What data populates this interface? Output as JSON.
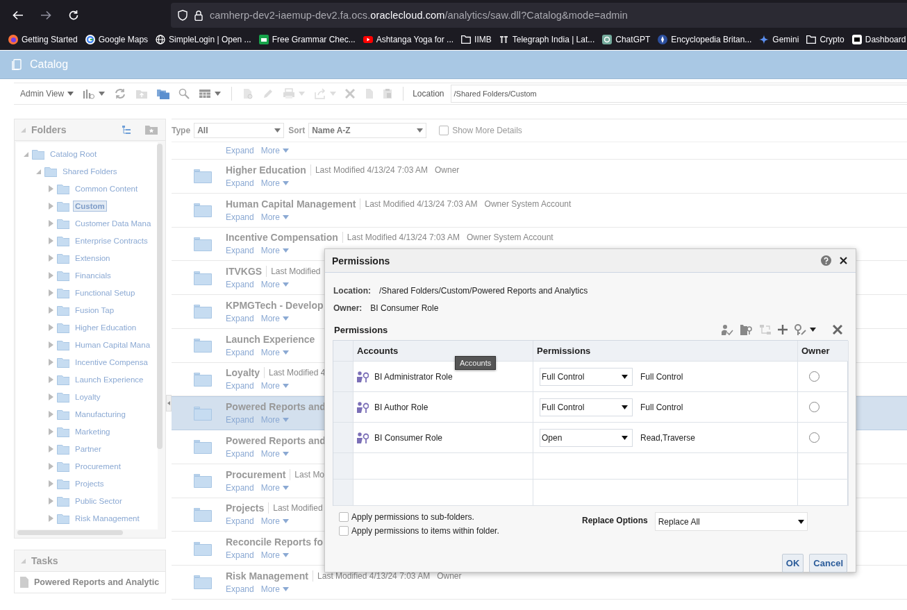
{
  "browser": {
    "url": "camherp-dev2-iaemup-dev2.fa.ocs.**oraclecloud.com**/analytics/saw.dll?Catalog&mode=admin",
    "bookmarks": [
      {
        "label": "Getting Started",
        "kind": "link"
      },
      {
        "label": "Google Maps",
        "kind": "link"
      },
      {
        "label": "SimpleLogin | Open ...",
        "kind": "link"
      },
      {
        "label": "Free Grammar Chec...",
        "kind": "link"
      },
      {
        "label": "Ashtanga Yoga for ...",
        "kind": "link"
      },
      {
        "label": "IIMB",
        "kind": "folder"
      },
      {
        "label": "Telegraph India | Lat...",
        "kind": "link"
      },
      {
        "label": "ChatGPT",
        "kind": "link"
      },
      {
        "label": "Encyclopedia Britan...",
        "kind": "link"
      },
      {
        "label": "Gemini",
        "kind": "link"
      },
      {
        "label": "Crypto",
        "kind": "folder"
      },
      {
        "label": "Dashboard",
        "kind": "link"
      }
    ]
  },
  "app": {
    "title": "Catalog"
  },
  "toolbar": {
    "view": "Admin View",
    "location_label": "Location",
    "location": "/Shared Folders/Custom"
  },
  "folders": {
    "title": "Folders",
    "tree": [
      {
        "label": "Catalog Root",
        "expanded": true,
        "selected": false,
        "children": [
          {
            "label": "Shared Folders",
            "expanded": true,
            "selected": false,
            "children": [
              {
                "label": "Common Content",
                "expanded": false,
                "selected": false
              },
              {
                "label": "Custom",
                "expanded": false,
                "selected": true
              },
              {
                "label": "Customer Data Mana",
                "expanded": false,
                "selected": false
              },
              {
                "label": "Enterprise Contracts",
                "expanded": false,
                "selected": false
              },
              {
                "label": "Extension",
                "expanded": false,
                "selected": false
              },
              {
                "label": "Financials",
                "expanded": false,
                "selected": false
              },
              {
                "label": "Functional Setup",
                "expanded": false,
                "selected": false
              },
              {
                "label": "Fusion Tap",
                "expanded": false,
                "selected": false
              },
              {
                "label": "Higher Education",
                "expanded": false,
                "selected": false
              },
              {
                "label": "Human Capital Mana",
                "expanded": false,
                "selected": false
              },
              {
                "label": "Incentive Compensa",
                "expanded": false,
                "selected": false
              },
              {
                "label": "Launch Experience",
                "expanded": false,
                "selected": false
              },
              {
                "label": "Loyalty",
                "expanded": false,
                "selected": false
              },
              {
                "label": "Manufacturing",
                "expanded": false,
                "selected": false
              },
              {
                "label": "Marketing",
                "expanded": false,
                "selected": false
              },
              {
                "label": "Partner",
                "expanded": false,
                "selected": false
              },
              {
                "label": "Procurement",
                "expanded": false,
                "selected": false
              },
              {
                "label": "Projects",
                "expanded": false,
                "selected": false
              },
              {
                "label": "Public Sector",
                "expanded": false,
                "selected": false
              },
              {
                "label": "Risk Management",
                "expanded": false,
                "selected": false
              }
            ]
          }
        ]
      }
    ]
  },
  "tasks": {
    "title": "Tasks",
    "item": "Powered Reports and Analytic"
  },
  "filters": {
    "type_label": "Type",
    "type": "All",
    "sort_label": "Sort",
    "sort": "Name A-Z",
    "details_label": "Show More Details",
    "details_checked": false
  },
  "items": [
    {
      "expand": "Expand",
      "more": "More",
      "selected": false
    },
    {
      "title": "Higher Education",
      "modified": "Last Modified 4/13/24 7:03 AM",
      "owner": "Owner",
      "expand": "Expand",
      "more": "More",
      "selected": false
    },
    {
      "title": "Human Capital Management",
      "modified": "Last Modified 4/13/24 7:03 AM",
      "owner": "Owner System Account",
      "expand": "Expand",
      "more": "More",
      "selected": false
    },
    {
      "title": "Incentive Compensation",
      "modified": "Last Modified 4/13/24 7:03 AM",
      "owner": "Owner System Account",
      "expand": "Expand",
      "more": "More",
      "selected": false
    },
    {
      "title": "ITVKGS",
      "modified": "Last Modified",
      "expand": "Expand",
      "more": "More",
      "selected": false
    },
    {
      "title": "KPMGTech - Develop",
      "expand": "Expand",
      "more": "More",
      "selected": false
    },
    {
      "title": "Launch Experience",
      "expand": "Expand",
      "more": "More",
      "selected": false
    },
    {
      "title": "Loyalty",
      "modified": "Last Modified 4",
      "expand": "Expand",
      "more": "More",
      "selected": false
    },
    {
      "title": "Powered Reports and",
      "expand": "Expand",
      "more": "More",
      "selected": true
    },
    {
      "title": "Powered Reports and",
      "expand": "Expand",
      "more": "More",
      "selected": false
    },
    {
      "title": "Procurement",
      "modified": "Last Mo",
      "expand": "Expand",
      "more": "More",
      "selected": false
    },
    {
      "title": "Projects",
      "modified": "Last Modified",
      "expand": "Expand",
      "more": "More",
      "selected": false
    },
    {
      "title": "Reconcile Reports fo",
      "expand": "Expand",
      "more": "More",
      "selected": false
    },
    {
      "title": "Risk Management",
      "modified": "Last Modified 4/13/24 7:03 AM",
      "owner": "Owner",
      "expand": "Expand",
      "more": "More",
      "selected": false
    }
  ],
  "dialog": {
    "title": "Permissions",
    "location_label": "Location:",
    "location": "/Shared Folders/Custom/Powered Reports and Analytics",
    "owner_label": "Owner:",
    "owner": "BI Consumer Role",
    "section": "Permissions",
    "columns": [
      "Accounts",
      "Permissions",
      "Owner"
    ],
    "rows": [
      {
        "kind": "account",
        "account": "BI Administrator Role",
        "permission": "Full Control",
        "detail": "Full Control",
        "selected": false
      },
      {
        "kind": "account",
        "account": "BI Author Role",
        "permission": "Full Control",
        "detail": "Full Control",
        "selected": false
      },
      {
        "kind": "account",
        "account": "BI Consumer Role",
        "permission": "Open",
        "detail": "Read,Traverse",
        "selected": false
      },
      {
        "kind": "empty"
      },
      {
        "kind": "empty"
      }
    ],
    "tooltip": "Accounts",
    "options": [
      {
        "label": "Apply permissions to sub-folders.",
        "checked": false
      },
      {
        "label": "Apply permissions to items within folder.",
        "checked": false
      }
    ],
    "replace_label": "Replace Options",
    "replace": "Replace All",
    "buttons": [
      "OK",
      "Cancel"
    ]
  }
}
